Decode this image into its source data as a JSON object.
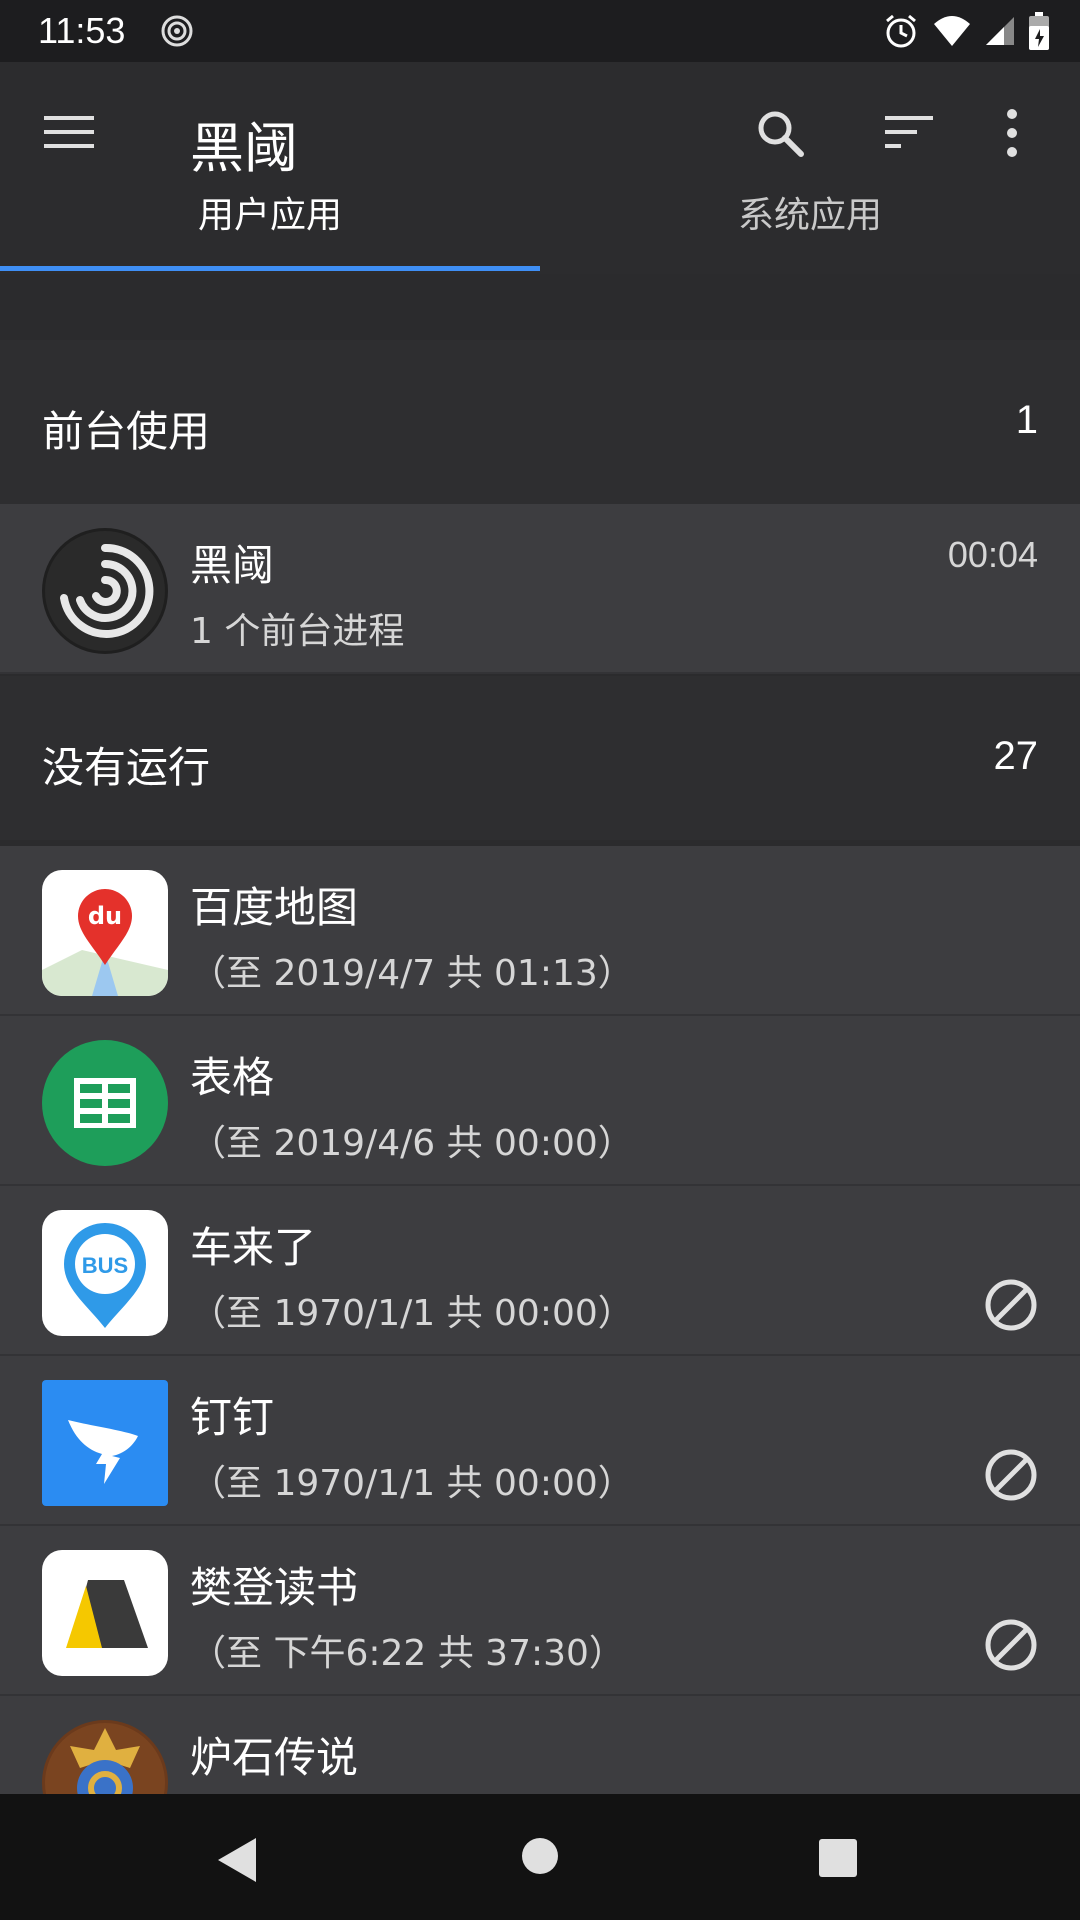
{
  "status_bar": {
    "time": "11:53",
    "icons": [
      "app-swirl-icon",
      "alarm-icon",
      "wifi-icon",
      "signal-icon",
      "battery-icon"
    ]
  },
  "app_bar": {
    "title": "黑阈",
    "icons": [
      "menu-icon",
      "search-icon",
      "sort-icon",
      "more-icon"
    ]
  },
  "tabs": [
    {
      "label": "用户应用",
      "selected": true
    },
    {
      "label": "系统应用",
      "selected": false
    }
  ],
  "sections": [
    {
      "label": "前台使用",
      "count": "1"
    },
    {
      "label": "没有运行",
      "count": "27"
    }
  ],
  "foreground_apps": [
    {
      "name": "黑阈",
      "detail": "1 个前台进程",
      "time": "00:04",
      "icon": "swirl-icon"
    }
  ],
  "stopped_apps": [
    {
      "name": "百度地图",
      "detail": "（至 2019/4/7 共 01:13）",
      "icon": "baidu-map-icon",
      "blocked": false
    },
    {
      "name": "表格",
      "detail": "（至 2019/4/6 共 00:00）",
      "icon": "sheets-icon",
      "blocked": false
    },
    {
      "name": "车来了",
      "detail": "（至 1970/1/1 共 00:00）",
      "icon": "bus-icon",
      "blocked": true
    },
    {
      "name": "钉钉",
      "detail": "（至 1970/1/1 共 00:00）",
      "icon": "dingtalk-icon",
      "blocked": true
    },
    {
      "name": "樊登读书",
      "detail": "（至 下午6:22 共 37:30）",
      "icon": "fandeng-icon",
      "blocked": true
    },
    {
      "name": "炉石传说",
      "detail": "",
      "icon": "hearthstone-icon",
      "blocked": false
    }
  ],
  "colors": {
    "accent": "#3f8ff5",
    "background": "#2b2b2d",
    "row": "#3d3d40"
  },
  "nav_bar": {
    "icons": [
      "back-icon",
      "home-icon",
      "recents-icon"
    ]
  }
}
